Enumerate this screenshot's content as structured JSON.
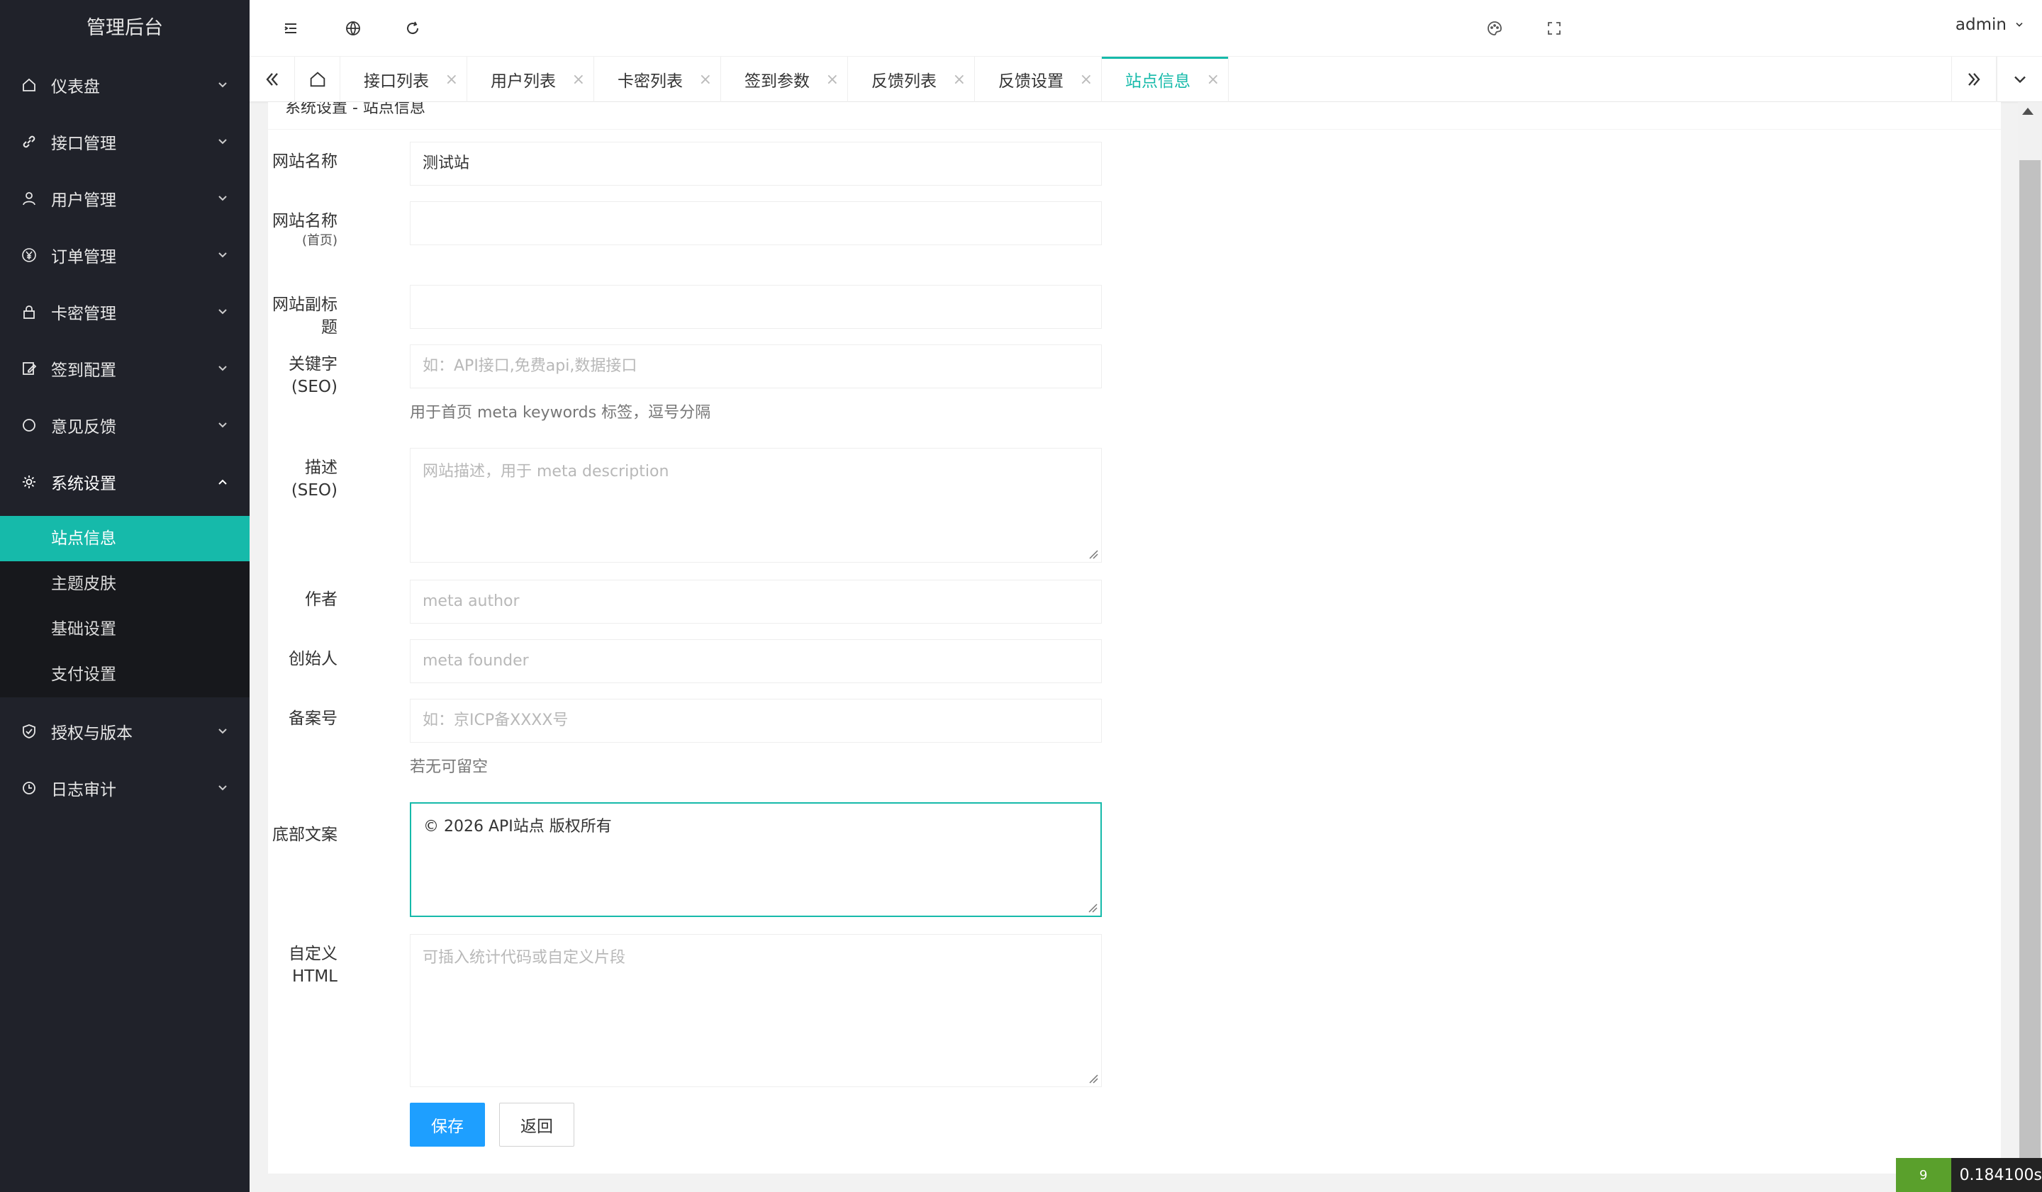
{
  "app": {
    "title": "管理后台"
  },
  "sidebar": {
    "items": [
      {
        "label": "仪表盘",
        "icon": "home-icon"
      },
      {
        "label": "接口管理",
        "icon": "link-icon"
      },
      {
        "label": "用户管理",
        "icon": "user-icon"
      },
      {
        "label": "订单管理",
        "icon": "yen-icon"
      },
      {
        "label": "卡密管理",
        "icon": "lock-icon"
      },
      {
        "label": "签到配置",
        "icon": "edit-icon"
      },
      {
        "label": "意见反馈",
        "icon": "circle-icon"
      },
      {
        "label": "系统设置",
        "icon": "gear-icon"
      }
    ],
    "sub_items": [
      {
        "label": "站点信息",
        "active": true
      },
      {
        "label": "主题皮肤"
      },
      {
        "label": "基础设置"
      },
      {
        "label": "支付设置"
      }
    ],
    "bottom_items": [
      {
        "label": "授权与版本",
        "icon": "shield-icon"
      },
      {
        "label": "日志审计",
        "icon": "clock-icon"
      }
    ]
  },
  "header": {
    "user": "admin"
  },
  "tabs": [
    {
      "label": "接口列表"
    },
    {
      "label": "用户列表"
    },
    {
      "label": "卡密列表"
    },
    {
      "label": "签到参数"
    },
    {
      "label": "反馈列表"
    },
    {
      "label": "反馈设置"
    },
    {
      "label": "站点信息",
      "active": true
    }
  ],
  "content": {
    "breadcrumb": "系统设置 - 站点信息",
    "fields": {
      "site_name": {
        "label": "网站名称",
        "value": "测试站"
      },
      "site_name_home": {
        "label": "网站名称",
        "sublabel": "(首页)",
        "value": ""
      },
      "subtitle": {
        "label": "网站副标题",
        "value": ""
      },
      "keywords": {
        "label": "关键字",
        "sublabel": "(SEO)",
        "placeholder": "如：API接口,免费api,数据接口",
        "help": "用于首页 meta keywords 标签，逗号分隔"
      },
      "description": {
        "label": "描述",
        "sublabel": "(SEO)",
        "placeholder": "网站描述，用于 meta description"
      },
      "author": {
        "label": "作者",
        "placeholder": "meta author"
      },
      "founder": {
        "label": "创始人",
        "placeholder": "meta founder"
      },
      "icp": {
        "label": "备案号",
        "placeholder": "如：京ICP备XXXX号",
        "help": "若无可留空"
      },
      "footer": {
        "label": "底部文案",
        "value": "© 2026 API站点 版权所有"
      },
      "custom_html": {
        "label": "自定义",
        "sublabel": "HTML",
        "placeholder": "可插入统计代码或自定义片段"
      }
    },
    "buttons": {
      "save": "保存",
      "back": "返回"
    }
  },
  "debug": {
    "time": "0.184100s",
    "logo_text": "9"
  },
  "colors": {
    "accent": "#16baaa",
    "primary": "#1e9fff",
    "sidebar": "#20222a"
  }
}
